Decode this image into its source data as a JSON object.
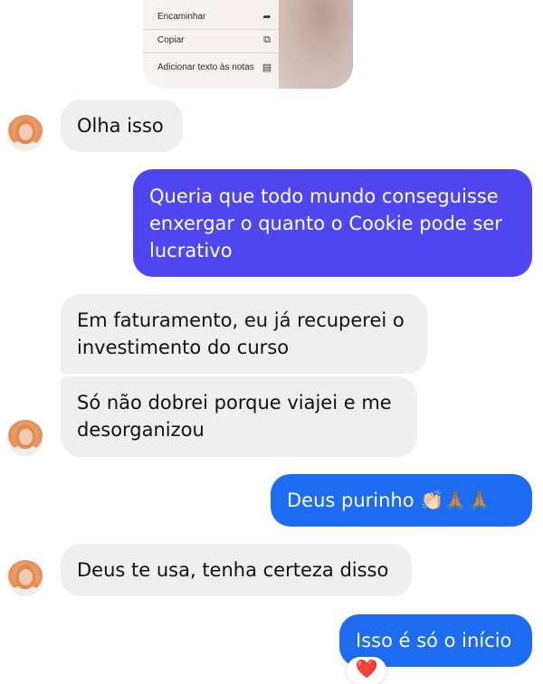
{
  "context_menu": {
    "items": [
      {
        "label": "Encaminhar",
        "icon": "forward-icon"
      },
      {
        "label": "Copiar",
        "icon": "copy-icon"
      },
      {
        "label": "Adicionar texto às notas",
        "icon": "note-icon"
      }
    ]
  },
  "messages": [
    {
      "text": "Olha isso"
    },
    {
      "text": "Queria que todo mundo conseguisse enxergar o quanto o Cookie pode ser lucrativo"
    },
    {
      "text": "Em faturamento, eu já recuperei o investimento do curso"
    },
    {
      "text": "Só não dobrei porque viajei e me desorganizou"
    },
    {
      "text": "Deus purinho 👏🏻🙏🏽🙏🏽"
    },
    {
      "text": "Deus te usa, tenha certeza disso"
    },
    {
      "text": "Isso é só o início"
    }
  ],
  "reaction": "❤️",
  "colors": {
    "incoming": "#efefef",
    "outgoing_purple": "#4f46ef",
    "outgoing_blue": "#1c6bf0"
  }
}
